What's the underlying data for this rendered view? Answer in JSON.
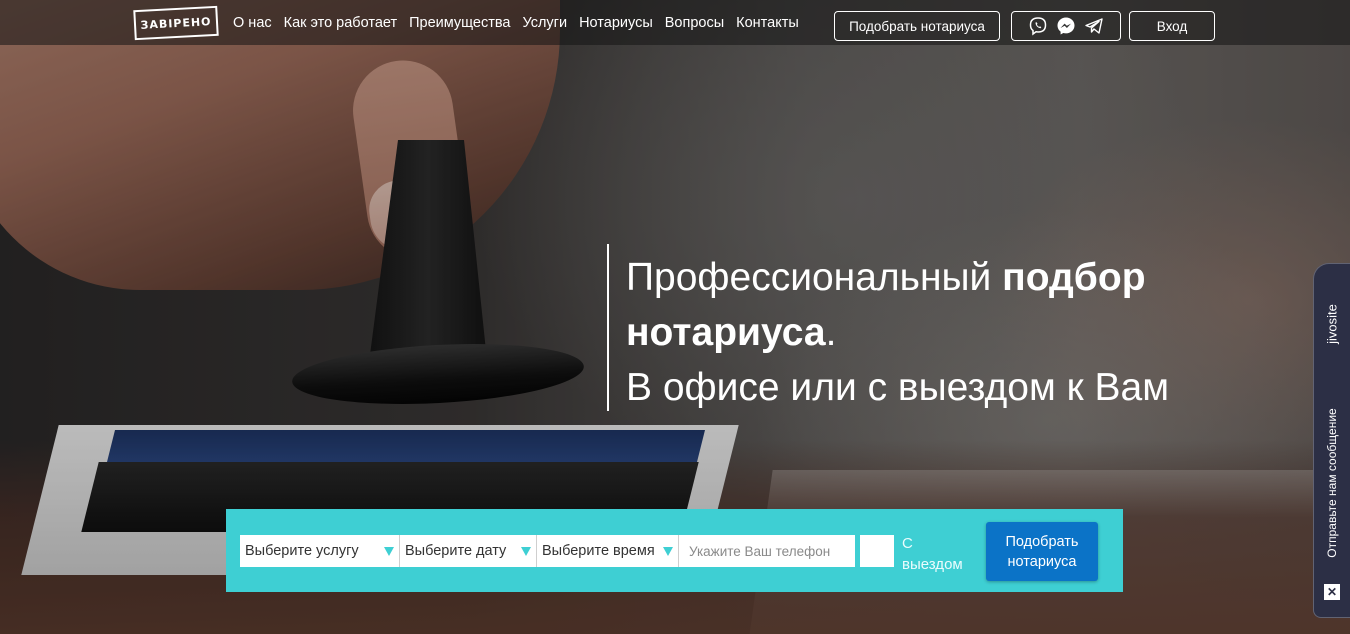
{
  "brand": {
    "logo_text": "ЗАВІРЕНО"
  },
  "nav": {
    "links": [
      "О нас",
      "Как это работает",
      "Преимущества",
      "Услуги",
      "Нотариусы",
      "Вопросы",
      "Контакты"
    ],
    "find_button": "Подобрать нотариуса",
    "messengers": [
      "viber-icon",
      "messenger-icon",
      "telegram-icon"
    ],
    "login_button": "Вход"
  },
  "hero": {
    "line1_regular": "Профессиональный ",
    "line1_bold": "подбор",
    "line2_bold": "нотариуса",
    "line2_dot": ".",
    "line3": "В офисе или с выездом к Вам"
  },
  "form": {
    "service_select": "Выберите услугу",
    "date_select": "Выберите дату",
    "time_select": "Выберите время",
    "phone_placeholder": "Укажите Ваш телефон",
    "outcall_label_line1": "С",
    "outcall_label_line2": "выездом",
    "submit_line1": "Подобрать",
    "submit_line2": "нотариуса"
  },
  "chat_widget": {
    "brand": "jivosite",
    "label": "Отправьте нам сообщение"
  },
  "colors": {
    "accent_teal": "#3ecfd3",
    "submit_blue": "#0b73c7",
    "widget_bg": "#2c2f45"
  }
}
